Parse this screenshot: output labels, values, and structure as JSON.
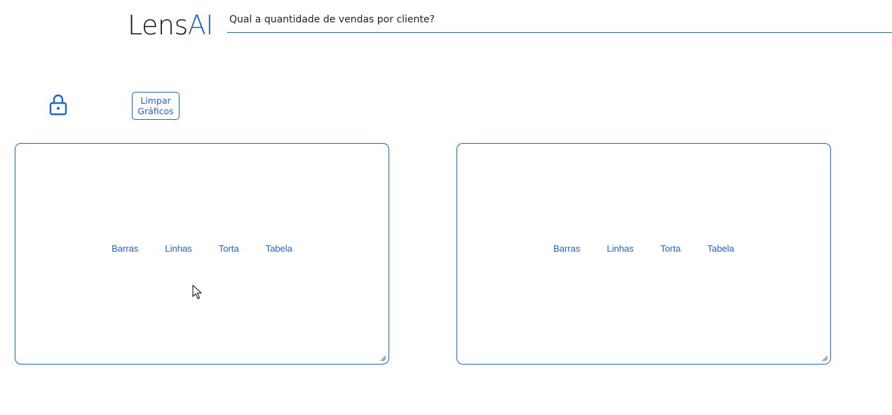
{
  "header": {
    "logo_text_dark": "Lens",
    "logo_text_accent": "AI",
    "query": "Qual a quantidade de vendas por cliente?"
  },
  "toolbar": {
    "lock_icon": "lock-icon",
    "clear_label_line1": "Limpar",
    "clear_label_line2": "Gráficos"
  },
  "panels": [
    {
      "options": [
        "Barras",
        "Linhas",
        "Torta",
        "Tabela"
      ]
    },
    {
      "options": [
        "Barras",
        "Linhas",
        "Torta",
        "Tabela"
      ]
    }
  ],
  "colors": {
    "accent": "#1a64d6",
    "text": "#111111",
    "underline": "#2a6a8a"
  }
}
